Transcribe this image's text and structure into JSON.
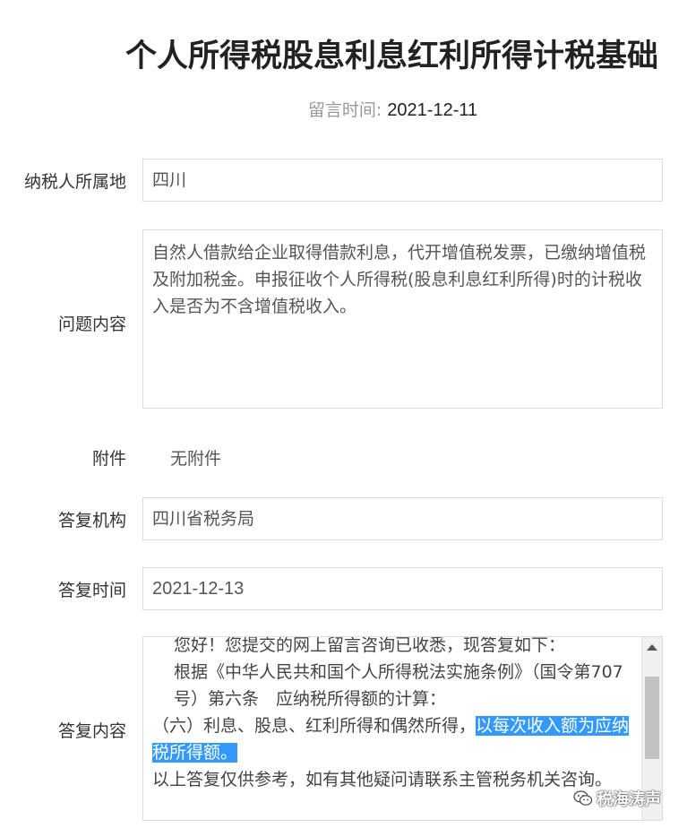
{
  "page": {
    "title": "个人所得税股息利息红利所得计税基础",
    "meta_label": "留言时间:",
    "meta_value": "2021-12-11"
  },
  "form": {
    "region_label": "纳税人所属地",
    "region_value": "四川",
    "question_label": "问题内容",
    "question_value": "自然人借款给企业取得借款利息，代开增值税发票，已缴纳增值税及附加税金。申报征收个人所得税(股息利息红利所得)时的计税收入是否为不含增值税收入。",
    "attachment_label": "附件",
    "attachment_value": "无附件",
    "org_label": "答复机构",
    "org_value": "四川省税务局",
    "reply_time_label": "答复时间",
    "reply_time_value": "2021-12-13",
    "reply_label": "答复内容",
    "reply_line1": "您好！您提交的网上留言咨询已收悉，现答复如下：",
    "reply_line2": "根据《中华人民共和国个人所得税法实施条例》（国令第707号）第六条　应纳税所得额的计算：",
    "reply_line3_pre": "（六）利息、股息、红利所得和偶然所得，",
    "reply_line3_hl": "以每次收入额为应纳税所得额。",
    "reply_line4": "以上答复仅供参考，如有其他疑问请联系主管税务机关咨询。"
  },
  "watermark": {
    "text": "税海涛声",
    "icon": "wechat-icon"
  },
  "colors": {
    "highlight": "#3399ff",
    "border": "#dcdcdc",
    "label_gray": "#999999"
  }
}
